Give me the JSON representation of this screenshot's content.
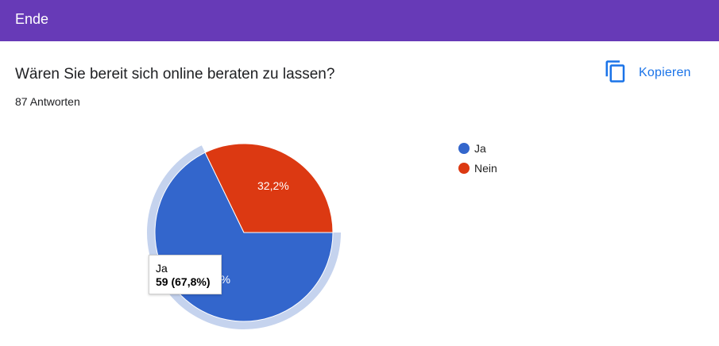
{
  "section": {
    "title": "Ende"
  },
  "question": {
    "title": "Wären Sie bereit sich online beraten zu lassen?",
    "responses": "87 Antworten"
  },
  "toolbar": {
    "copy_label": "Kopieren",
    "copy_icon": "copy-icon"
  },
  "chart_data": {
    "type": "pie",
    "categories": [
      "Ja",
      "Nein"
    ],
    "values": [
      59,
      28
    ],
    "percent_labels": [
      "67,8%",
      "32,2%"
    ],
    "colors": [
      "#3366cc",
      "#dc3912"
    ],
    "legend_position": "right",
    "highlighted": "Ja"
  },
  "tooltip": {
    "label": "Ja",
    "value": "59 (67,8%)"
  }
}
